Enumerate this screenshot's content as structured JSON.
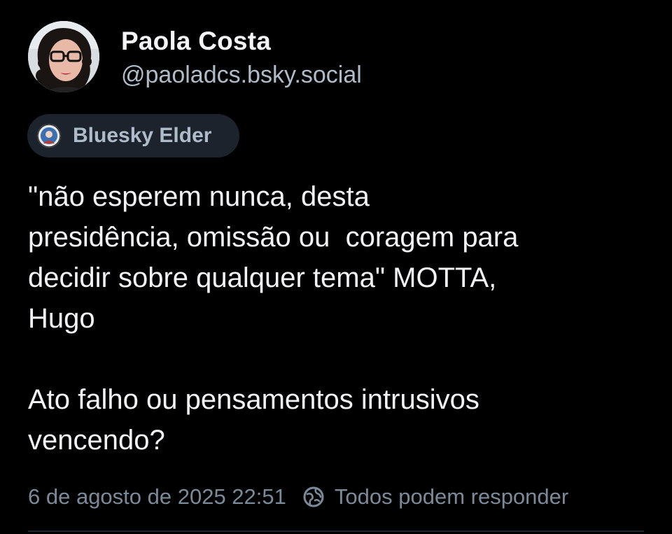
{
  "post": {
    "author": {
      "display_name": "Paola Costa",
      "handle": "@paoladcs.bsky.social",
      "avatar_icon": "profile-photo"
    },
    "badge": {
      "label": "Bluesky Elder",
      "icon": "elder-badge-icon"
    },
    "text": "\"não esperem nunca, desta\npresidência, omissão ou  coragem para\ndecidir sobre qualquer tema\" MOTTA,\nHugo\n\nAto falho ou pensamentos intrusivos\nvencendo?",
    "timestamp": "6 de agosto de 2025 22:51",
    "reply_setting": {
      "label": "Todos podem responder",
      "icon": "globe-icon"
    }
  },
  "colors": {
    "background": "#000000",
    "text_primary": "#f1f3f5",
    "text_secondary": "#aebbc9",
    "text_muted": "#7b8a99",
    "badge_bg": "#1c232c"
  }
}
